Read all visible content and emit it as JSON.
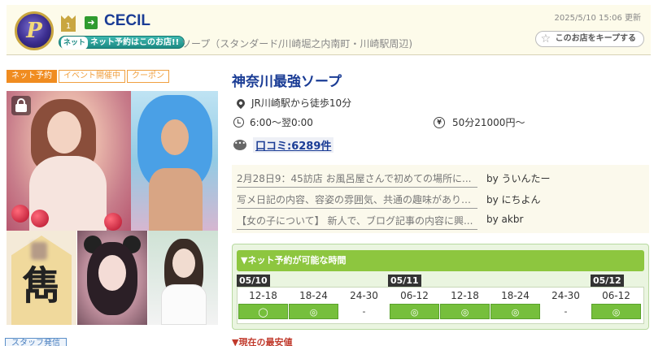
{
  "header": {
    "shop_name": "CECIL",
    "rank": "1",
    "updated": "2025/5/10 15:06 更新",
    "net_badge_pill": "ネット",
    "net_badge": "ネット予約はこのお店!!",
    "category": "ソープ（スタンダード/川崎堀之内南町・川崎駅周辺)",
    "keep_button": "このお店をキープする"
  },
  "tags": [
    "ネット予約",
    "イベント開催中",
    "クーポン"
  ],
  "photos": {
    "shogi_piece_text": "雋"
  },
  "staff_tab": "スタッフ発信",
  "shop": {
    "title": "神奈川最強ソープ",
    "access": "JR川崎駅から徒歩10分",
    "hours": "6:00～翌0:00",
    "price": "50分21000円～",
    "reviews_link": "口コミ:6289件"
  },
  "reviews": [
    {
      "text": "2月28日9：45訪店 お風呂屋さんで初めての場所に...",
      "by": "by ういんたー"
    },
    {
      "text": "写メ日記の内容、容姿の雰囲気、共通の趣味がありそ...",
      "by": "by にちよん"
    },
    {
      "text": "【女の子について】 新人で、ブログ記事の内容に興...",
      "by": "by akbr"
    }
  ],
  "booking": {
    "header": "▼ネット予約が可能な時間",
    "dates": [
      "05/10",
      "05/11",
      "05/12"
    ],
    "slots": [
      {
        "time": "12-18",
        "mark": "◯",
        "available": true
      },
      {
        "time": "18-24",
        "mark": "◎",
        "available": true
      },
      {
        "time": "24-30",
        "mark": "-",
        "available": false
      },
      {
        "time": "06-12",
        "mark": "◎",
        "available": true
      },
      {
        "time": "12-18",
        "mark": "◎",
        "available": true
      },
      {
        "time": "18-24",
        "mark": "◎",
        "available": true
      },
      {
        "time": "24-30",
        "mark": "-",
        "available": false
      },
      {
        "time": "06-12",
        "mark": "◎",
        "available": true
      }
    ]
  },
  "cheapest": "▼現在の最安値",
  "colors": {
    "brand_blue": "#1a3c95",
    "tag_orange": "#f08c20",
    "booking_green": "#8dc63f",
    "header_bg": "#fdfbea"
  }
}
